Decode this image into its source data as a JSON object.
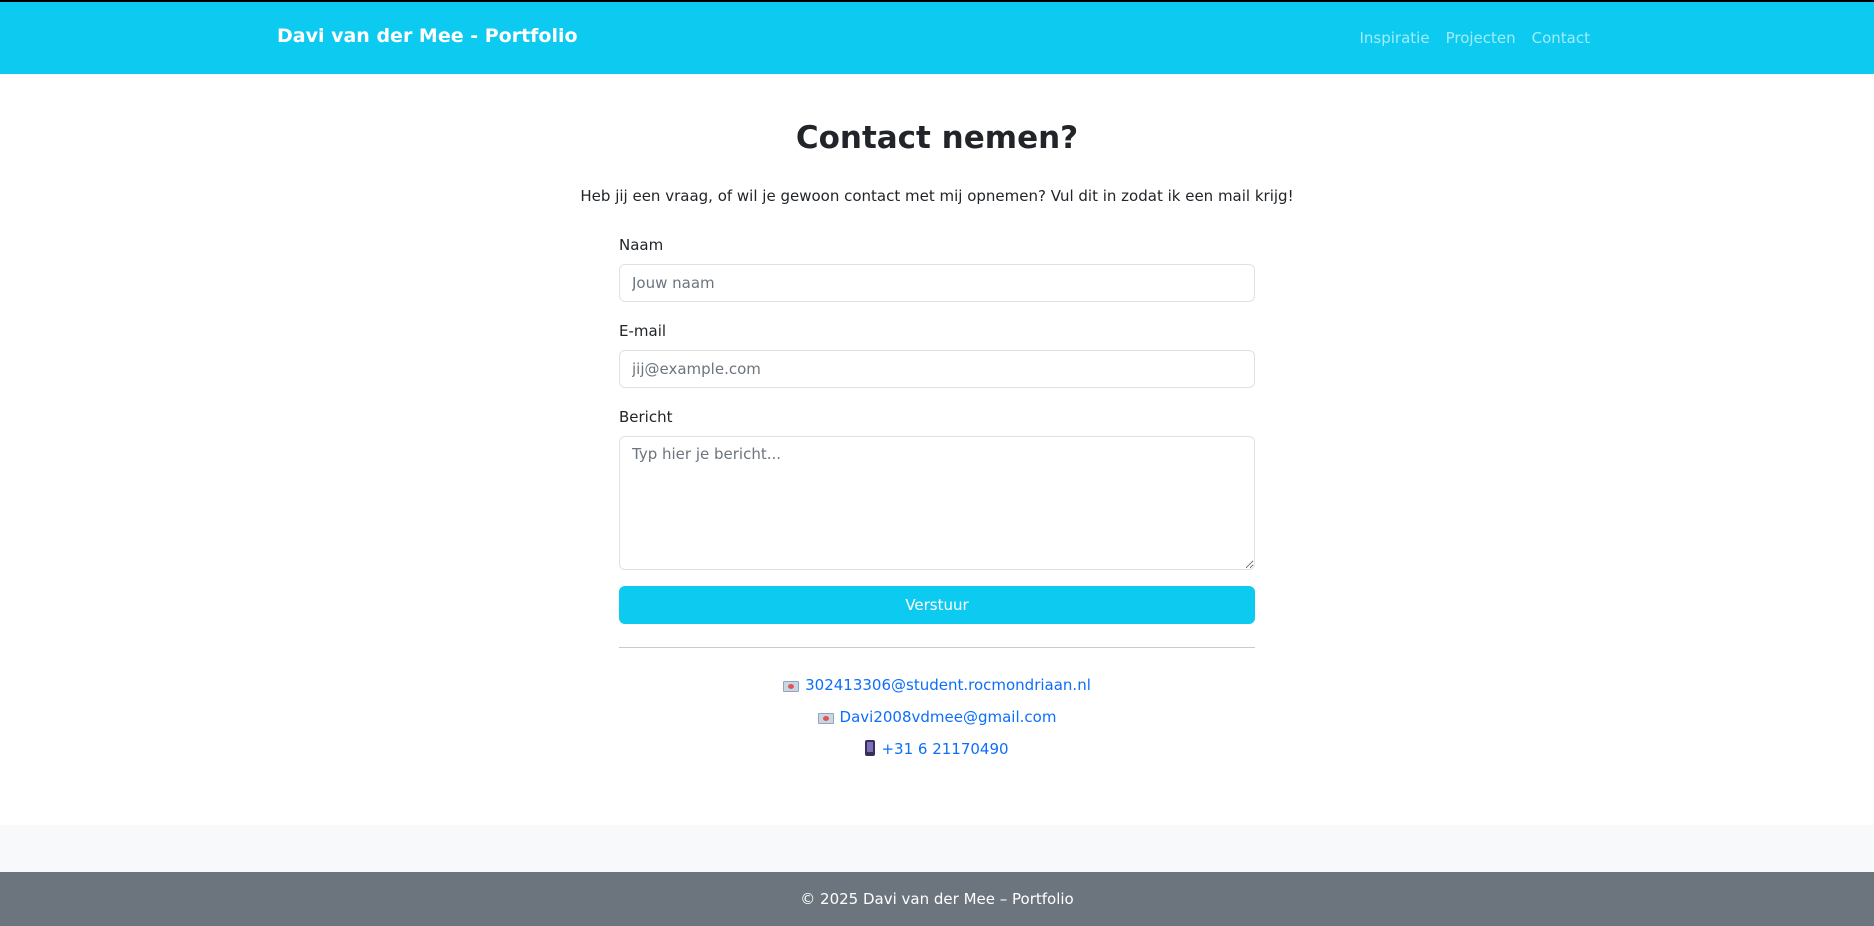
{
  "nav": {
    "brand": "Davi van der Mee - Portfolio",
    "links": [
      "Inspiratie",
      "Projecten",
      "Contact"
    ]
  },
  "page": {
    "title": "Contact nemen?",
    "intro": "Heb jij een vraag, of wil je gewoon contact met mij opnemen? Vul dit in zodat ik een mail krijg!"
  },
  "form": {
    "name_label": "Naam",
    "name_placeholder": "Jouw naam",
    "email_label": "E-mail",
    "email_placeholder": "jij@example.com",
    "message_label": "Bericht",
    "message_placeholder": "Typ hier je bericht...",
    "submit_label": "Verstuur"
  },
  "contacts": {
    "school_email": "302413306@student.rocmondriaan.nl",
    "personal_email": "Davi2008vdmee@gmail.com",
    "phone": "+31 6 21170490"
  },
  "footer": {
    "text": "© 2025 Davi van der Mee – Portfolio"
  },
  "colors": {
    "primary": "#0dcaf0",
    "link": "#0d6efd",
    "footer": "#6c757d"
  }
}
